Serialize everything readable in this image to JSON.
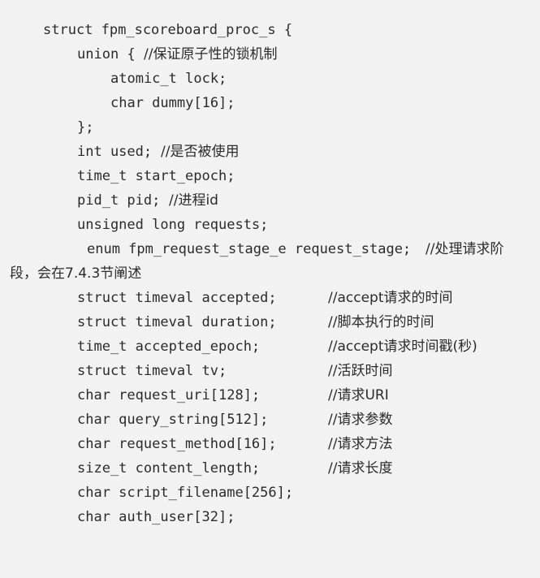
{
  "code": {
    "lines": [
      {
        "code": "struct fpm_scoreboard_proc_s {"
      },
      {
        "code": "union { ",
        "comment": "//保证原子性的锁机制"
      },
      {
        "code": "atomic_t lock;"
      },
      {
        "code": "char dummy[16];"
      },
      {
        "code": "};"
      },
      {
        "code": "int used; ",
        "comment": "//是否被使用"
      },
      {
        "code": "time_t start_epoch;"
      },
      {
        "code": "pid_t pid; ",
        "comment": "//进程id"
      },
      {
        "code": "unsigned long requests;"
      },
      {
        "code": "enum fpm_request_stage_e request_stage; ",
        "comment": "//处理请求阶"
      },
      {
        "code": "段，会在7.4.3节阐述"
      },
      {
        "code": "struct timeval accepted;",
        "comment": "//accept请求的时间"
      },
      {
        "code": "struct timeval duration;",
        "comment": "//脚本执行的时间"
      },
      {
        "code": "time_t accepted_epoch;",
        "comment": "//accept请求时间戳(秒)"
      },
      {
        "code": "struct timeval tv;",
        "comment": "//活跃时间"
      },
      {
        "code": "char request_uri[128];",
        "comment": "//请求URI"
      },
      {
        "code": "char query_string[512];",
        "comment": "//请求参数"
      },
      {
        "code": "char request_method[16];",
        "comment": "//请求方法"
      },
      {
        "code": "size_t content_length;",
        "comment": "//请求长度"
      },
      {
        "code": "char script_filename[256];"
      },
      {
        "code": "char auth_user[32];"
      }
    ]
  }
}
